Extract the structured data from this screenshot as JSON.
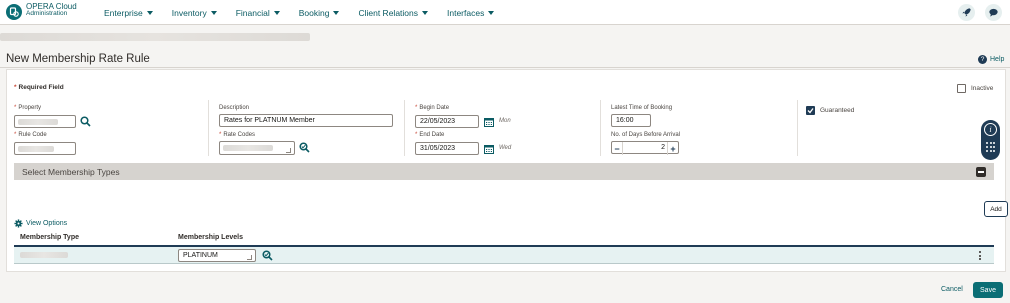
{
  "app": {
    "brand_line1": "OPERA Cloud",
    "brand_line2": "Administration"
  },
  "nav": [
    "Enterprise",
    "Inventory",
    "Financial",
    "Booking",
    "Client Relations",
    "Interfaces"
  ],
  "page": {
    "title": "New Membership Rate Rule",
    "help_label": "Help"
  },
  "form": {
    "required_label": "Required Field",
    "inactive_label": "Inactive",
    "property_label": "Property",
    "rule_code_label": "Rule Code",
    "description_label": "Description",
    "description_value": "Rates for PLATNUM Member",
    "rate_codes_label": "Rate Codes",
    "begin_date_label": "Begin Date",
    "begin_date_value": "22/05/2023",
    "begin_day": "Mon",
    "end_date_label": "End Date",
    "end_date_value": "31/05/2023",
    "end_day": "Wed",
    "latest_time_label": "Latest Time of Booking",
    "latest_time_value": "16:00",
    "days_before_label": "No. of Days Before Arrival",
    "days_before_value": "2",
    "guaranteed_label": "Guaranteed",
    "guaranteed_checked": true,
    "inactive_checked": false
  },
  "section": {
    "title": "Select Membership Types",
    "view_options": "View Options",
    "add_label": "Add",
    "columns": [
      "Membership Type",
      "Membership Levels"
    ],
    "rows": [
      {
        "membership_level": "PLATINUM"
      }
    ]
  },
  "footer": {
    "cancel_label": "Cancel",
    "save_label": "Save"
  },
  "colors": {
    "brand": "#0b6e75",
    "nav_text": "#0b5b63",
    "accent_dark": "#1f3b55",
    "required": "#c74634"
  }
}
